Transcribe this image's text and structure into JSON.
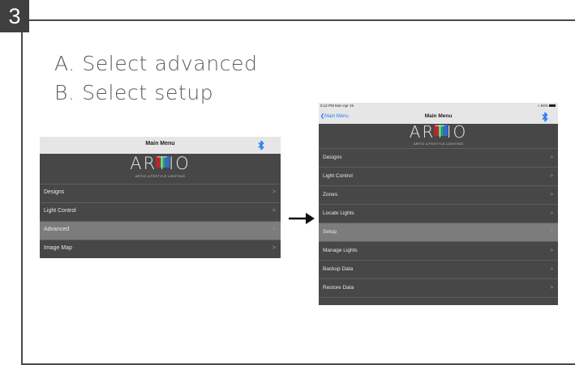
{
  "step": {
    "number": "3"
  },
  "instructions": [
    "A. Select advanced",
    "B. Select setup"
  ],
  "screen_small": {
    "title": "Main Menu",
    "logo": {
      "pre": "AR",
      "mid": "T",
      "post": "IO",
      "tagline": "ARTIO LIFESTYLE LIGHTING"
    },
    "items": [
      {
        "label": "Designs",
        "selected": false
      },
      {
        "label": "Light Control",
        "selected": false
      },
      {
        "label": "Advanced",
        "selected": true
      },
      {
        "label": "Image Map",
        "selected": false
      }
    ],
    "chevron": ">"
  },
  "screen_large": {
    "status_time": "5:12 PM  Mon Apr 15",
    "status_battery": "94%",
    "back_label": "Main Menu",
    "title": "Main Menu",
    "logo": {
      "pre": "AR",
      "mid": "T",
      "post": "IO",
      "tagline": "ARTIO LIFESTYLE LIGHTING"
    },
    "items": [
      {
        "label": "Designs",
        "selected": false
      },
      {
        "label": "Light Control",
        "selected": false
      },
      {
        "label": "Zones",
        "selected": false
      },
      {
        "label": "Locate Lights",
        "selected": false
      },
      {
        "label": "Setup",
        "selected": true
      },
      {
        "label": "Manage Lights",
        "selected": false
      },
      {
        "label": "Backup Data",
        "selected": false
      },
      {
        "label": "Restore Data",
        "selected": false
      }
    ],
    "chevron": ">"
  },
  "colors": {
    "accent": "#2f7cf6",
    "panel": "#474747",
    "selected": "#7c7c7c",
    "navbar": "#e6e6e6"
  }
}
